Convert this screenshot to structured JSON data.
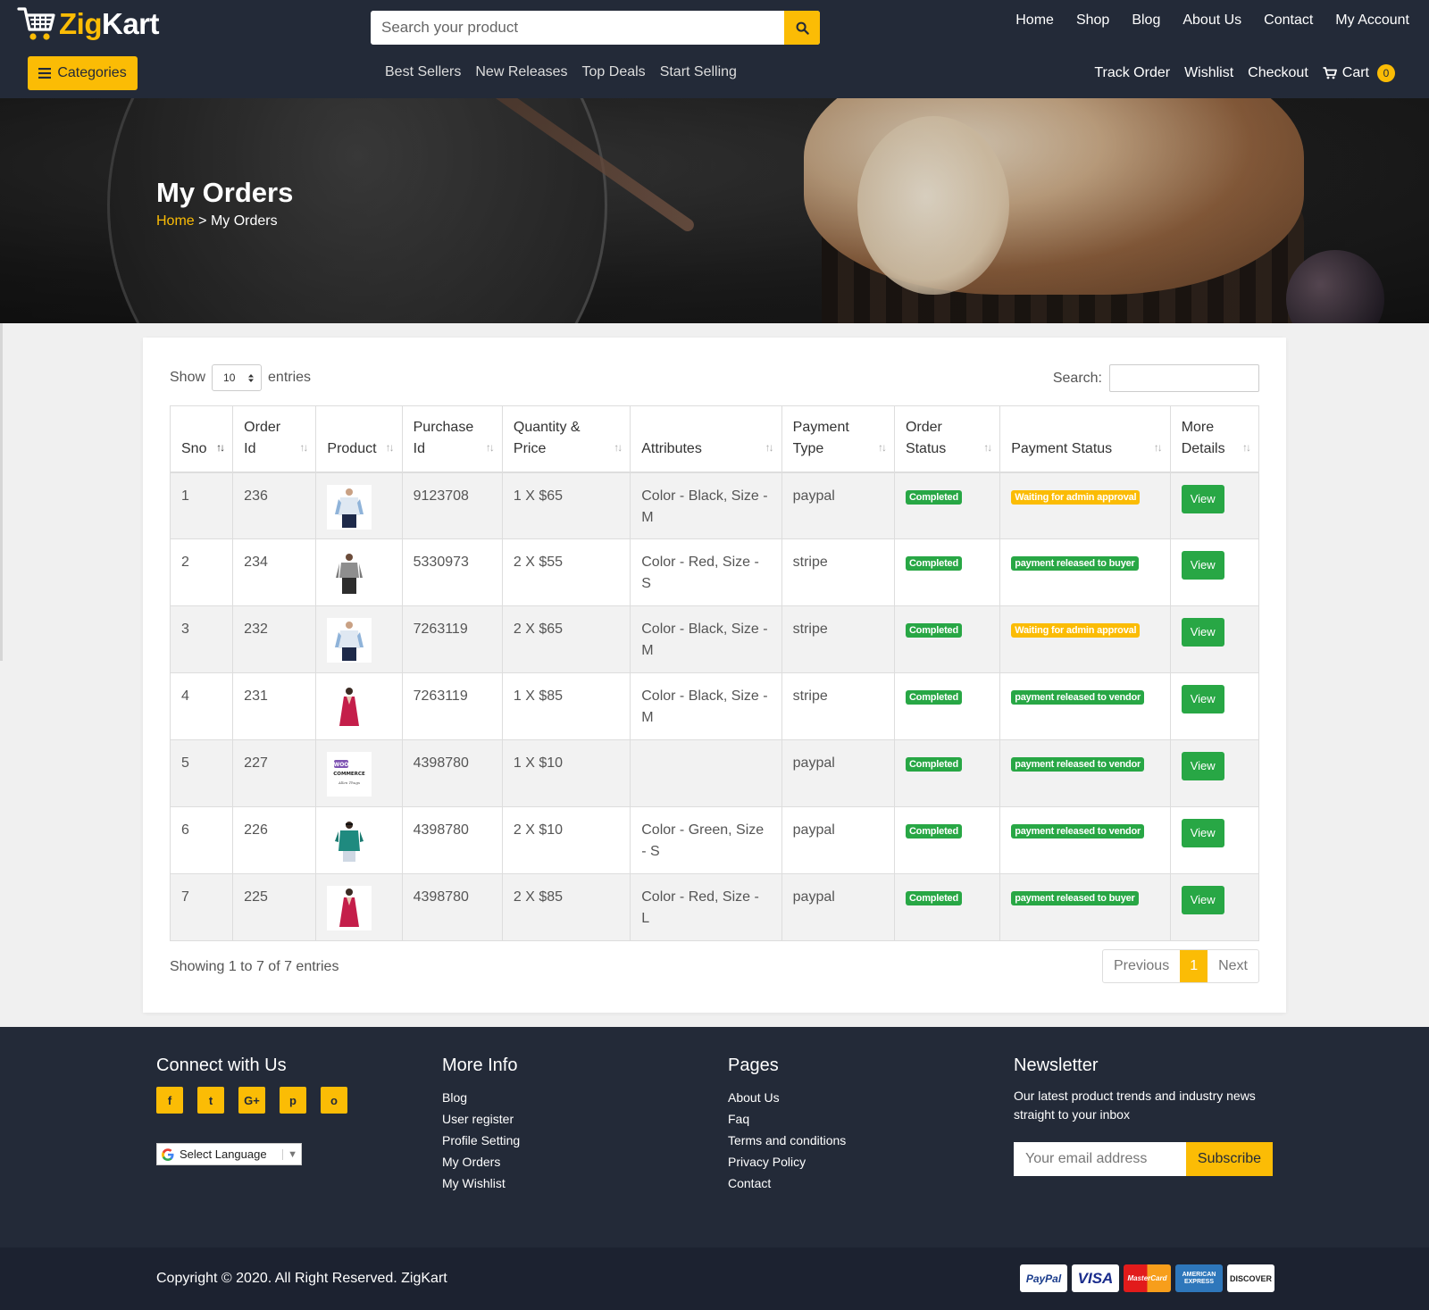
{
  "brand": {
    "zig": "Zig",
    "kart": "Kart"
  },
  "search": {
    "placeholder": "Search your product"
  },
  "top_nav": [
    "Home",
    "Shop",
    "Blog",
    "About Us",
    "Contact",
    "My Account"
  ],
  "categories_label": "Categories",
  "sub_nav": [
    "Best Sellers",
    "New Releases",
    "Top Deals",
    "Start Selling"
  ],
  "sub_nav_right": {
    "track": "Track Order",
    "wishlist": "Wishlist",
    "checkout": "Checkout",
    "cart": "Cart",
    "cart_count": "0"
  },
  "hero": {
    "title": "My Orders",
    "breadcrumb_home": "Home",
    "breadcrumb_sep": ">",
    "breadcrumb_current": "My Orders"
  },
  "table_controls": {
    "show": "Show",
    "entries_value": "10",
    "entries": "entries",
    "search_label": "Search:"
  },
  "columns": [
    {
      "line1": "Sno",
      "line2": ""
    },
    {
      "line1": "Order",
      "line2": "Id"
    },
    {
      "line1": "Product",
      "line2": ""
    },
    {
      "line1": "Purchase",
      "line2": "Id"
    },
    {
      "line1": "Quantity &",
      "line2": "Price"
    },
    {
      "line1": "Attributes",
      "line2": ""
    },
    {
      "line1": "Payment",
      "line2": "Type"
    },
    {
      "line1": "Order",
      "line2": "Status"
    },
    {
      "line1": "Payment Status",
      "line2": ""
    },
    {
      "line1": "More",
      "line2": "Details"
    }
  ],
  "orders": [
    {
      "sno": "1",
      "order_id": "236",
      "product": "shirt-white",
      "purchase_id": "9123708",
      "qty_price": "1 X $65",
      "attributes": "Color - Black, Size - M",
      "payment_type": "paypal",
      "order_status": "Completed",
      "payment_status": "Waiting for admin approval",
      "payment_status_color": "yellow",
      "action": "View"
    },
    {
      "sno": "2",
      "order_id": "234",
      "product": "top-grey",
      "purchase_id": "5330973",
      "qty_price": "2 X $55",
      "attributes": "Color - Red, Size - S",
      "payment_type": "stripe",
      "order_status": "Completed",
      "payment_status": "payment released to buyer",
      "payment_status_color": "green",
      "action": "View"
    },
    {
      "sno": "3",
      "order_id": "232",
      "product": "shirt-white",
      "purchase_id": "7263119",
      "qty_price": "2 X $65",
      "attributes": "Color - Black, Size - M",
      "payment_type": "stripe",
      "order_status": "Completed",
      "payment_status": "Waiting for admin approval",
      "payment_status_color": "yellow",
      "action": "View"
    },
    {
      "sno": "4",
      "order_id": "231",
      "product": "dress-red",
      "purchase_id": "7263119",
      "qty_price": "1 X $85",
      "attributes": "Color - Black, Size - M",
      "payment_type": "stripe",
      "order_status": "Completed",
      "payment_status": "payment released to vendor",
      "payment_status_color": "green",
      "action": "View"
    },
    {
      "sno": "5",
      "order_id": "227",
      "product": "woocommerce-logo",
      "purchase_id": "4398780",
      "qty_price": "1 X $10",
      "attributes": "",
      "payment_type": "paypal",
      "order_status": "Completed",
      "payment_status": "payment released to vendor",
      "payment_status_color": "green",
      "action": "View"
    },
    {
      "sno": "6",
      "order_id": "226",
      "product": "top-green",
      "purchase_id": "4398780",
      "qty_price": "2 X $10",
      "attributes": "Color - Green, Size - S",
      "payment_type": "paypal",
      "order_status": "Completed",
      "payment_status": "payment released to vendor",
      "payment_status_color": "green",
      "action": "View"
    },
    {
      "sno": "7",
      "order_id": "225",
      "product": "dress-red",
      "purchase_id": "4398780",
      "qty_price": "2 X $85",
      "attributes": "Color - Red, Size - L",
      "payment_type": "paypal",
      "order_status": "Completed",
      "payment_status": "payment released to buyer",
      "payment_status_color": "green",
      "action": "View"
    }
  ],
  "woo_logo_text": {
    "woo": "WOO",
    "commerce": "COMMERCE",
    "sign": "Allen Thugs"
  },
  "showing_text": "Showing 1 to 7 of 7 entries",
  "pagination": {
    "previous": "Previous",
    "current": "1",
    "next": "Next"
  },
  "footer": {
    "connect_title": "Connect with Us",
    "socials": [
      "facebook-icon",
      "twitter-icon",
      "google-plus-icon",
      "pinterest-icon",
      "instagram-icon"
    ],
    "social_glyphs": [
      "f",
      "t",
      "G+",
      "p",
      "o"
    ],
    "language_label": "Select Language",
    "more_info_title": "More Info",
    "more_info": [
      "Blog",
      "User register",
      "Profile Setting",
      "My Orders",
      "My Wishlist"
    ],
    "pages_title": "Pages",
    "pages": [
      "About Us",
      "Faq",
      "Terms and conditions",
      "Privacy Policy",
      "Contact"
    ],
    "newsletter_title": "Newsletter",
    "newsletter_text": "Our latest product trends and industry news straight to your inbox",
    "email_placeholder": "Your email address",
    "subscribe": "Subscribe"
  },
  "copyright": "Copyright © 2020. All Right Reserved. ZigKart",
  "payment_cards": [
    "PayPal",
    "VISA",
    "MasterCard",
    "AMERICAN EXPRESS",
    "DISCOVER"
  ],
  "colors": {
    "navy": "#232a38",
    "accent": "#fbbc05",
    "success": "#28a745"
  }
}
